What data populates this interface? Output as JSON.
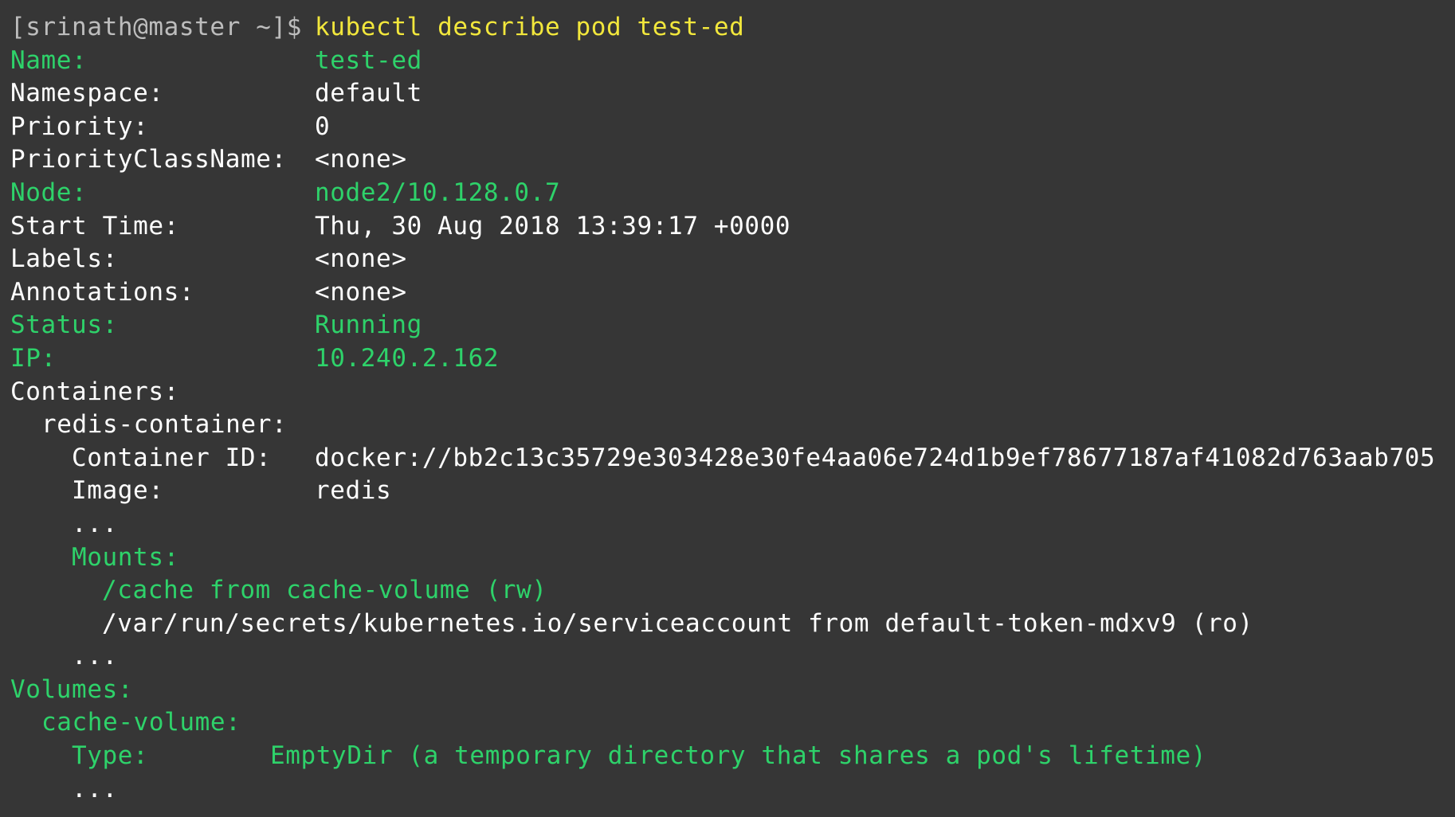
{
  "colors": {
    "background": "#363636",
    "text": "#ffffff",
    "highlight_green": "#2ed26a",
    "command_yellow": "#f2e73c",
    "prompt_grey": "#bdbdbd"
  },
  "prompt": {
    "text": "[srinath@master ~]$",
    "command": "kubectl describe pod test-ed"
  },
  "fields": {
    "name": {
      "key": "Name:",
      "value": "test-ed"
    },
    "namespace": {
      "key": "Namespace:",
      "value": "default"
    },
    "priority": {
      "key": "Priority:",
      "value": "0"
    },
    "priority_class": {
      "key": "PriorityClassName:",
      "value": "<none>"
    },
    "node": {
      "key": "Node:",
      "value": "node2/10.128.0.7"
    },
    "start_time": {
      "key": "Start Time:",
      "value": "Thu, 30 Aug 2018 13:39:17 +0000"
    },
    "labels": {
      "key": "Labels:",
      "value": "<none>"
    },
    "annotations": {
      "key": "Annotations:",
      "value": "<none>"
    },
    "status": {
      "key": "Status:",
      "value": "Running"
    },
    "ip": {
      "key": "IP:",
      "value": "10.240.2.162"
    }
  },
  "containers": {
    "header": "Containers:",
    "container_name": "redis-container:",
    "container_id": {
      "key": "Container ID:",
      "value": "docker://bb2c13c35729e303428e30fe4aa06e724d1b9ef78677187af41082d763aab705"
    },
    "image": {
      "key": "Image:",
      "value": "redis"
    },
    "ellipsis_1": "...",
    "mounts_header": "Mounts:",
    "mount_cache": "/cache from cache-volume (rw)",
    "mount_secrets": "/var/run/secrets/kubernetes.io/serviceaccount from default-token-mdxv9 (ro)",
    "ellipsis_2": "..."
  },
  "volumes": {
    "header": "Volumes:",
    "volume_name": "cache-volume:",
    "type": {
      "key": "Type:",
      "value": "EmptyDir (a temporary directory that shares a pod's lifetime)"
    },
    "ellipsis": "..."
  }
}
